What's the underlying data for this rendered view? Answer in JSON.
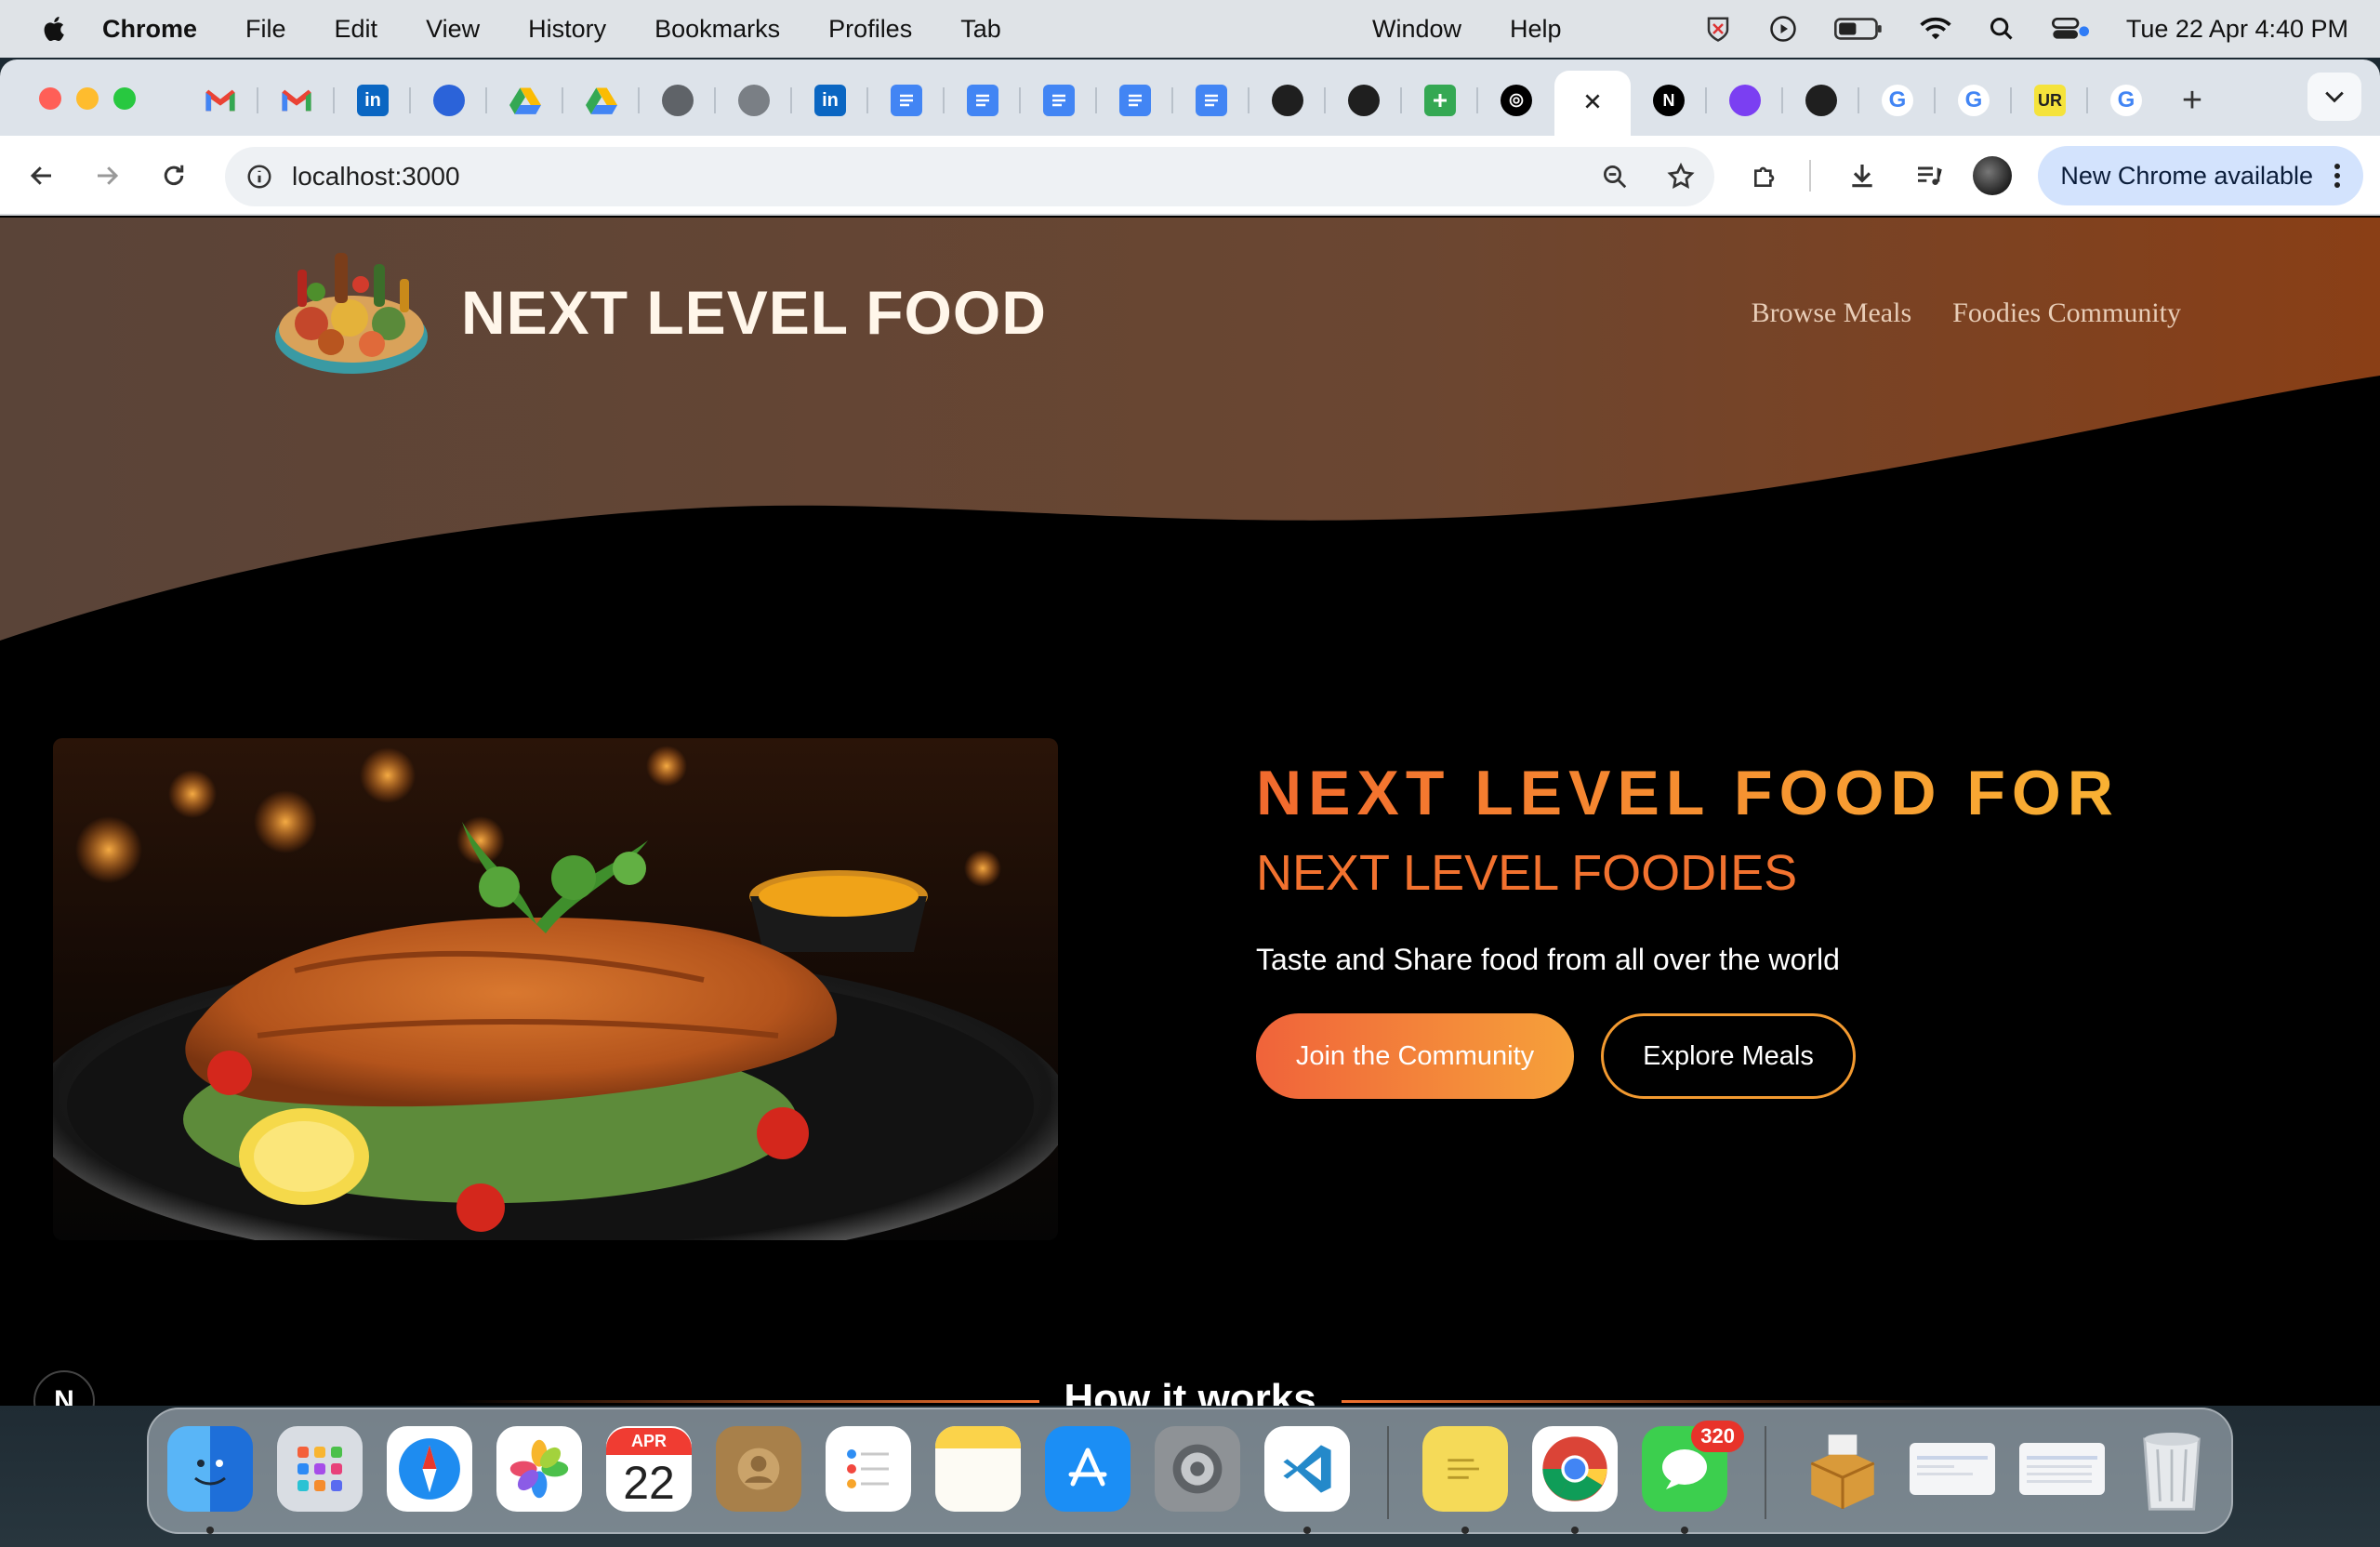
{
  "menubar": {
    "app_name": "Chrome",
    "items": [
      "File",
      "Edit",
      "View",
      "History",
      "Bookmarks",
      "Profiles",
      "Tab"
    ],
    "items_right": [
      "Window",
      "Help"
    ],
    "clock": "Tue 22 Apr  4:40 PM"
  },
  "browser": {
    "url": "localhost:3000",
    "update_label": "New Chrome available",
    "tabs": [
      {
        "icon": "gmail-icon"
      },
      {
        "icon": "gmail-icon"
      },
      {
        "icon": "linkedin-icon"
      },
      {
        "icon": "globe-blue-icon"
      },
      {
        "icon": "google-drive-icon"
      },
      {
        "icon": "google-drive-icon"
      },
      {
        "icon": "globe-icon"
      },
      {
        "icon": "globe-icon"
      },
      {
        "icon": "linkedin-icon"
      },
      {
        "icon": "google-docs-icon"
      },
      {
        "icon": "google-docs-icon"
      },
      {
        "icon": "google-docs-icon"
      },
      {
        "icon": "google-docs-icon"
      },
      {
        "icon": "google-docs-icon"
      },
      {
        "icon": "github-icon"
      },
      {
        "icon": "github-icon"
      },
      {
        "icon": "google-sheets-icon"
      },
      {
        "icon": "openai-icon"
      },
      {
        "icon": "close-icon",
        "active": true
      },
      {
        "icon": "nextjs-icon"
      },
      {
        "icon": "purple-app-icon"
      },
      {
        "icon": "github-icon"
      },
      {
        "icon": "google-icon"
      },
      {
        "icon": "google-icon"
      },
      {
        "icon": "ur-icon"
      },
      {
        "icon": "google-icon"
      }
    ],
    "tab_icon_text": {
      "linkedin": "in",
      "ur": "UR",
      "google": "G",
      "nextjs": "N"
    }
  },
  "site": {
    "title": "NEXT LEVEL FOOD",
    "nav": [
      "Browse Meals",
      "Foodies Community"
    ],
    "hero": {
      "heading": "NEXT LEVEL FOOD FOR",
      "subheading": "NEXT LEVEL FOODIES",
      "tagline": "Taste and Share food from all over the world",
      "primary_cta": "Join the Community",
      "secondary_cta": "Explore Meals"
    },
    "section_title": "How it works",
    "dev_badge": "N"
  },
  "colors": {
    "accent_orange": "#f2722f",
    "accent_gold": "#f9b233",
    "header_brown": "#6b4a3a",
    "nav_text": "#e8cdb7"
  },
  "dock": {
    "calendar_month": "APR",
    "calendar_day": "22",
    "messages_badge": "320",
    "apps": [
      "finder-icon",
      "launchpad-icon",
      "safari-icon",
      "photos-icon",
      "calendar-icon",
      "contacts-icon",
      "reminders-icon",
      "notes-icon",
      "app-store-icon",
      "system-settings-icon",
      "vscode-icon",
      "stickies-icon",
      "chrome-icon",
      "messages-icon",
      "archive-utility-icon",
      "screenshot-icon",
      "screenshot-icon",
      "trash-icon"
    ]
  }
}
